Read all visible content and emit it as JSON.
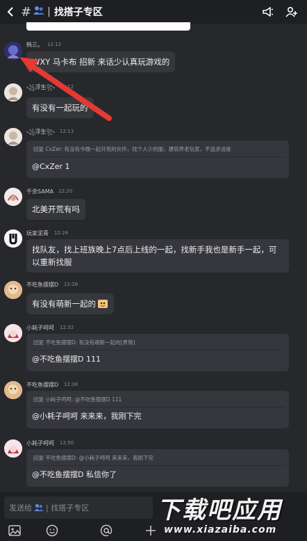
{
  "header": {
    "channel_name": "找搭子专区",
    "hash": "#"
  },
  "messages": [
    {
      "name": "韩三。",
      "time": "12:12",
      "text": "WXY 马卡布 招新 来话少认真玩游戏的"
    },
    {
      "name": "浮生",
      "time": "12:12",
      "text": "有没有一起玩的"
    },
    {
      "name": "浮生",
      "time": "12:13",
      "quote": "回复 CxZer: 有没有今晚一起开荒的伙伴，找个人少的服，建筑养老玩家，不追求进度",
      "text": "@CxZer 1"
    },
    {
      "name": "千余SAMA",
      "time": "12:20",
      "text": "北美开荒有吗"
    },
    {
      "name": "玩家泥青",
      "time": "12:24",
      "text": "找队友，找上班族晚上7点后上线的一起，找新手我也是新手一起，可以重新找服"
    },
    {
      "name": "不吃鱼摆摆D",
      "time": "12:26",
      "text": "有没有萌新一起的"
    },
    {
      "name": "小耗子呵呵",
      "time": "12:32",
      "quote": "回复 不吃鱼摆摆D: 有没有萌新一起的[表情]",
      "text": "@不吃鱼摆摆D 111"
    },
    {
      "name": "不吃鱼摆摆D",
      "time": "12:38",
      "quote": "回复 小耗子呵呵: @不吃鱼摆摆D 111",
      "text": "@小耗子呵呵 来来来，我刚下完"
    },
    {
      "name": "小耗子呵呵",
      "time": "12:50",
      "quote": "回复 不吃鱼摆摆D: @小耗子呵呵 来来来，我刚下完",
      "text": "@不吃鱼摆摆D 私信你了"
    }
  ],
  "input": {
    "placeholder": "发送给",
    "channel": "| 找搭子专区"
  },
  "watermark": {
    "main": "下载吧应用",
    "url": "www.xiazaiba.com"
  },
  "colors": {
    "background": "#27282c",
    "bubble": "#36373c",
    "header": "#1e1f22",
    "arrow": "#e53935"
  },
  "icons": [
    "back-arrow-icon",
    "megaphone-icon",
    "add-member-icon",
    "image-icon",
    "emoji-icon",
    "at-icon",
    "plus-icon"
  ]
}
